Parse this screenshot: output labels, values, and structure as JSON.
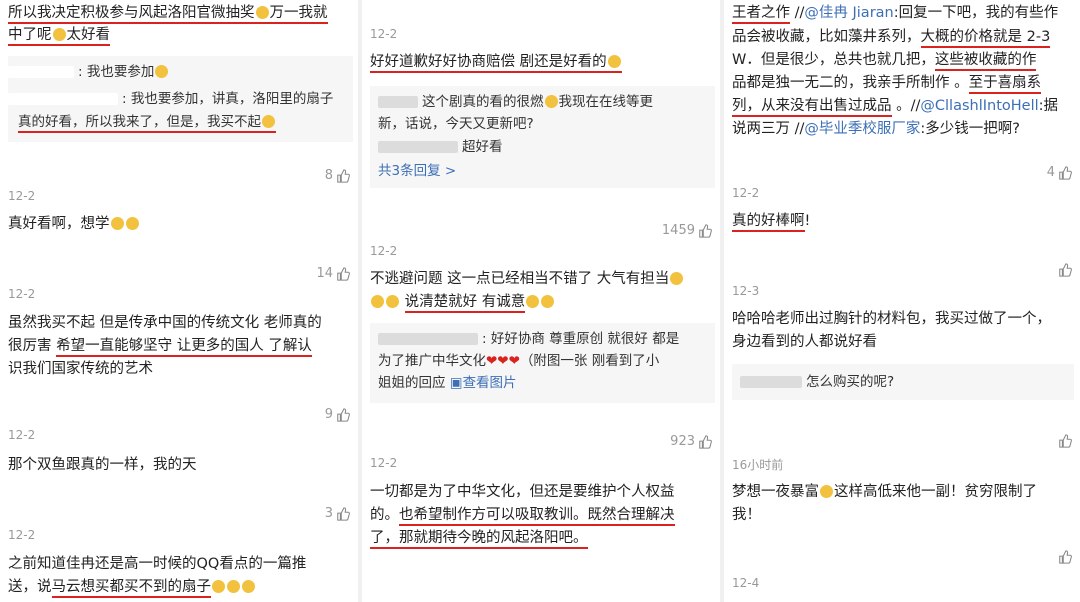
{
  "col1": {
    "top_line1": "所以我决定积极参与风起洛阳官微抽奖",
    "top_line1b": "万一我就",
    "top_line2": "中了呢",
    "top_line2b": "太好看",
    "reply1": ": 我也要参加",
    "reply2a": ": 我也要参加，讲真，洛阳里的扇子",
    "reply2b": "真的好看，所以我来了，但是，我买不起",
    "like1": "8",
    "date1": "12-2",
    "c2": "真好看啊，想学",
    "like2": "14",
    "date2": "12-2",
    "c3a": "虽然我买不起  但是传承中国的传统文化  老师真的",
    "c3b_pre": "很厉害  ",
    "c3b_u": "希望一直能够坚守  让更多的国人  了解认",
    "c3c": "识我们国家传统的艺术",
    "like3": "9",
    "date3": "12-2",
    "c4": "那个双鱼跟真的一样，我的天",
    "like4": "3",
    "date4": "12-2",
    "c5a": "之前知道佳冉还是高一时候的QQ看点的一篇推",
    "c5b_pre": "送，说",
    "c5b_u": "马云想买都买不到的扇子"
  },
  "col2": {
    "date0": "12-2",
    "c1": "好好道歉好好协商赔偿  剧还是好看的",
    "r1a": "这个剧真的看的很燃",
    "r1a2": "我现在在线等更",
    "r1b": "新，话说，今天又更新吧?",
    "r2": "超好看",
    "more": "共3条回复 >",
    "like1": "1459",
    "date1": "12-2",
    "c2a": "不逃避问题  这一点已经相当不错了  大气有担当",
    "c2b_u": "说清楚就好  有诚意",
    "r3a": ": 好好协商  尊重原创  就很好  都是",
    "r3b": "为了推广中华文化",
    "r3b2": "（附图一张  刚看到了小",
    "r3c": "姐姐的回应",
    "view_img": "查看图片",
    "like2": "923",
    "date2": "12-2",
    "c3a": "一切都是为了中华文化，但还是要维护个人权益",
    "c3b_pre": "的。",
    "c3b_u": "也希望制作方可以吸取教训。既然合理解决",
    "c3c_u": "了，那就期待今晚的风起洛阳吧。"
  },
  "col3": {
    "c1a_u": "王者之作",
    "c1a_pre": " //",
    "c1a_link": "@佳冉 Jiaran",
    "c1a_rest": ":回复一下吧，我的有些作",
    "c1b_pre": "品会被收藏，比如藻井系列，",
    "c1b_u": "大概的价格就是 2-3",
    "c1c_pre": "W．但是很少，总共也就几把，",
    "c1c_u": "这些被收藏的作",
    "c1d": "品都是独一无二的，我亲手所制作 。",
    "c1d_u": "至于喜扇系",
    "c1e_u": "列，从来没有出售过成品",
    "c1e_sep": " 。//",
    "c1e_link": "@CllashlIntoHell",
    "c1e_rest": ":据",
    "c1f": "说两三万 //",
    "c1f_link": "@毕业季校服厂家",
    "c1f_rest": ":多少钱一把啊?",
    "like1": "4",
    "date1": "12-2",
    "c2_u": "真的好棒啊",
    "c2_end": "!",
    "date2": "12-3",
    "c3a": "哈哈哈老师出过胸针的材料包，我买过做了一个，",
    "c3b": "身边看到的人都说好看",
    "r1": "怎么购买的呢?",
    "date3": "16小时前",
    "c4a_pre": "梦想一夜暴富",
    "c4a_post": "这样高低来他一副！贫穷限制了",
    "c4b": "我！",
    "date4": "12-4"
  },
  "colors": {
    "underline": "#d9231e",
    "link": "#3d6fb6",
    "reply_bg": "#f6f6f6",
    "muted": "#999999"
  }
}
